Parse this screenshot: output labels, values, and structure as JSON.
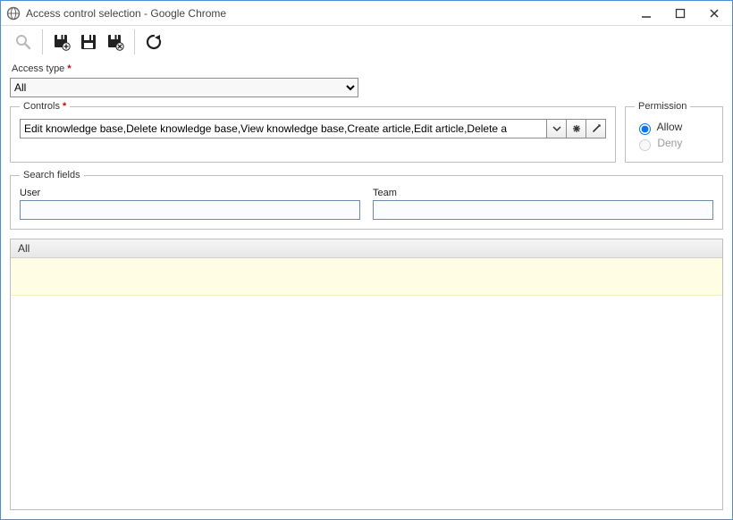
{
  "window": {
    "title": "Access control selection - Google Chrome"
  },
  "accessType": {
    "label": "Access type",
    "required": "*",
    "selected": "All",
    "options": [
      "All"
    ]
  },
  "controls": {
    "legend": "Controls",
    "required": "*",
    "value": "Edit knowledge base,Delete knowledge base,View knowledge base,Create article,Edit article,Delete a"
  },
  "permission": {
    "legend": "Permission",
    "allow_label": "Allow",
    "deny_label": "Deny",
    "selected": "allow",
    "deny_enabled": false
  },
  "search": {
    "legend": "Search fields",
    "user": {
      "label": "User",
      "value": ""
    },
    "team": {
      "label": "Team",
      "value": ""
    }
  },
  "results": {
    "header": "All"
  }
}
